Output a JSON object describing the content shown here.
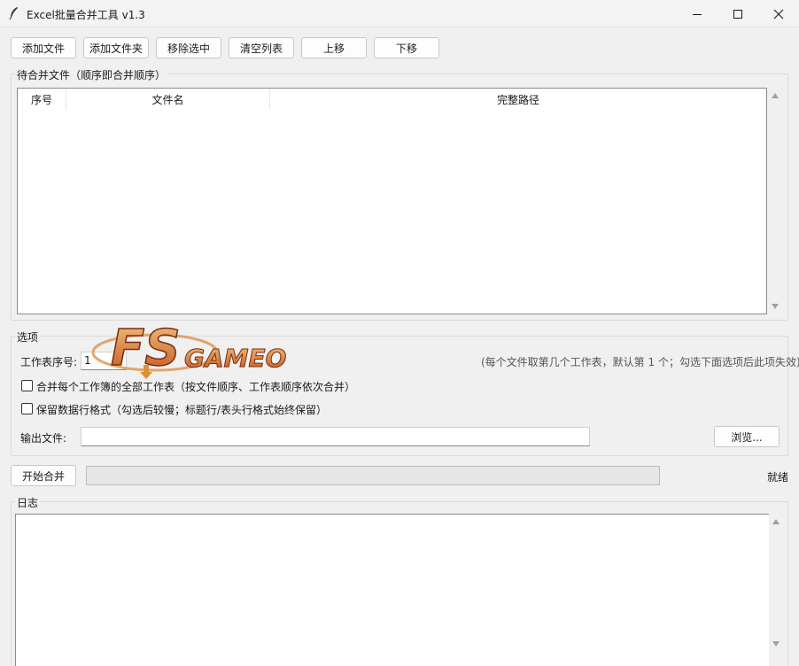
{
  "window": {
    "title": "Excel批量合并工具 v1.3",
    "controls": [
      "minimize",
      "maximize",
      "close"
    ]
  },
  "toolbar": {
    "add_file": "添加文件",
    "add_folder": "添加文件夹",
    "remove_selected": "移除选中",
    "clear_list": "清空列表",
    "move_up": "上移",
    "move_down": "下移"
  },
  "files_group": {
    "label": "待合并文件（顺序即合并顺序）",
    "columns": [
      "序号",
      "文件名",
      "完整路径"
    ],
    "rows": []
  },
  "options_group": {
    "label": "选项",
    "sheet_index_label": "工作表序号:",
    "sheet_index_value": "1",
    "sheet_index_hint": "(每个文件取第几个工作表，默认第 1 个；勾选下面选项后此项失效)",
    "merge_all_sheets": {
      "checked": false,
      "label": "合并每个工作簿的全部工作表（按文件顺序、工作表顺序依次合并）"
    },
    "keep_format": {
      "checked": false,
      "label": "保留数据行格式（勾选后较慢；标题行/表头行格式始终保留）"
    },
    "output_label": "输出文件:",
    "output_value": "",
    "browse": "浏览..."
  },
  "action": {
    "start_merge": "开始合并",
    "progress": 0,
    "status": "就绪"
  },
  "log_group": {
    "label": "日志",
    "content": ""
  },
  "watermark": {
    "text": "FS GAMEO",
    "color": "#e0902e"
  }
}
